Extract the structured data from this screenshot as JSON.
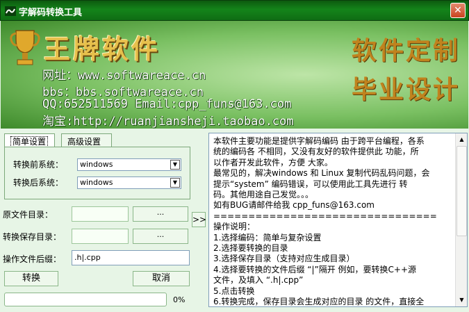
{
  "window": {
    "title": "字解码转换工具",
    "close_label": "✕"
  },
  "banner": {
    "brand": "王牌软件",
    "lines": [
      "网址：www.softwareace.cn",
      "bbs：bbs.softwareace.cn",
      "QQ:652511569  Email:cpp_funs@163.com",
      "淘宝:http://ruanjiansheji.taobao.com"
    ],
    "slogan": [
      "软件定制",
      "毕业设计"
    ]
  },
  "tabs": [
    {
      "label": "简单设置",
      "active": true
    },
    {
      "label": "高级设置",
      "active": false
    }
  ],
  "simple_settings": {
    "source_label": "转换前系统：",
    "source_value": "windows",
    "target_label": "转换后系统：",
    "target_value": "windows"
  },
  "fields": {
    "source_dir_label": "原文件目录：",
    "save_dir_label": "转换保存目录：",
    "suffix_label": "操作文件后缀：",
    "suffix_value": ".h|.cpp",
    "browse_label": "...",
    "expand_label": ">>"
  },
  "buttons": {
    "convert": "转换",
    "cancel": "取消"
  },
  "progress": {
    "value": 0,
    "text": "0%"
  },
  "description": [
    "本软件主要功能是提供字解码编码 由于跨平台编程，各系",
    "统的编码各 不相同，又没有友好的软件提供此 功能，所",
    "以作者开发此软件，方便 大家。",
    "最常见的，解决windows 和 Linux 复制代码乱码问题，会",
    "提示“system” 编码错误，可以使用此工具先进行 转",
    "码。其他用途自己发觉。。。",
    "如有BUG请邮件给我 cpp_funs@163.com",
    "================================",
    "操作说明：",
    " 1.选择编码：简单与复杂设置",
    "2.选择要转换的目录",
    "3.选择保存目录（支持对应生成目录）",
    "4.选择要转换的文件后缀 “|”隔开 例如，要转换C++源",
    "文件，及填入 “.h|.cpp”",
    "5.点击转换",
    "6.转换完成，保存目录会生成对应的目录 的文件，直接全"
  ],
  "colors": {
    "title_bar": "#14841a",
    "banner_bg": "#7ac062",
    "panel_bg": "#e7f5e6",
    "brand_gold": "#e7c04c"
  }
}
